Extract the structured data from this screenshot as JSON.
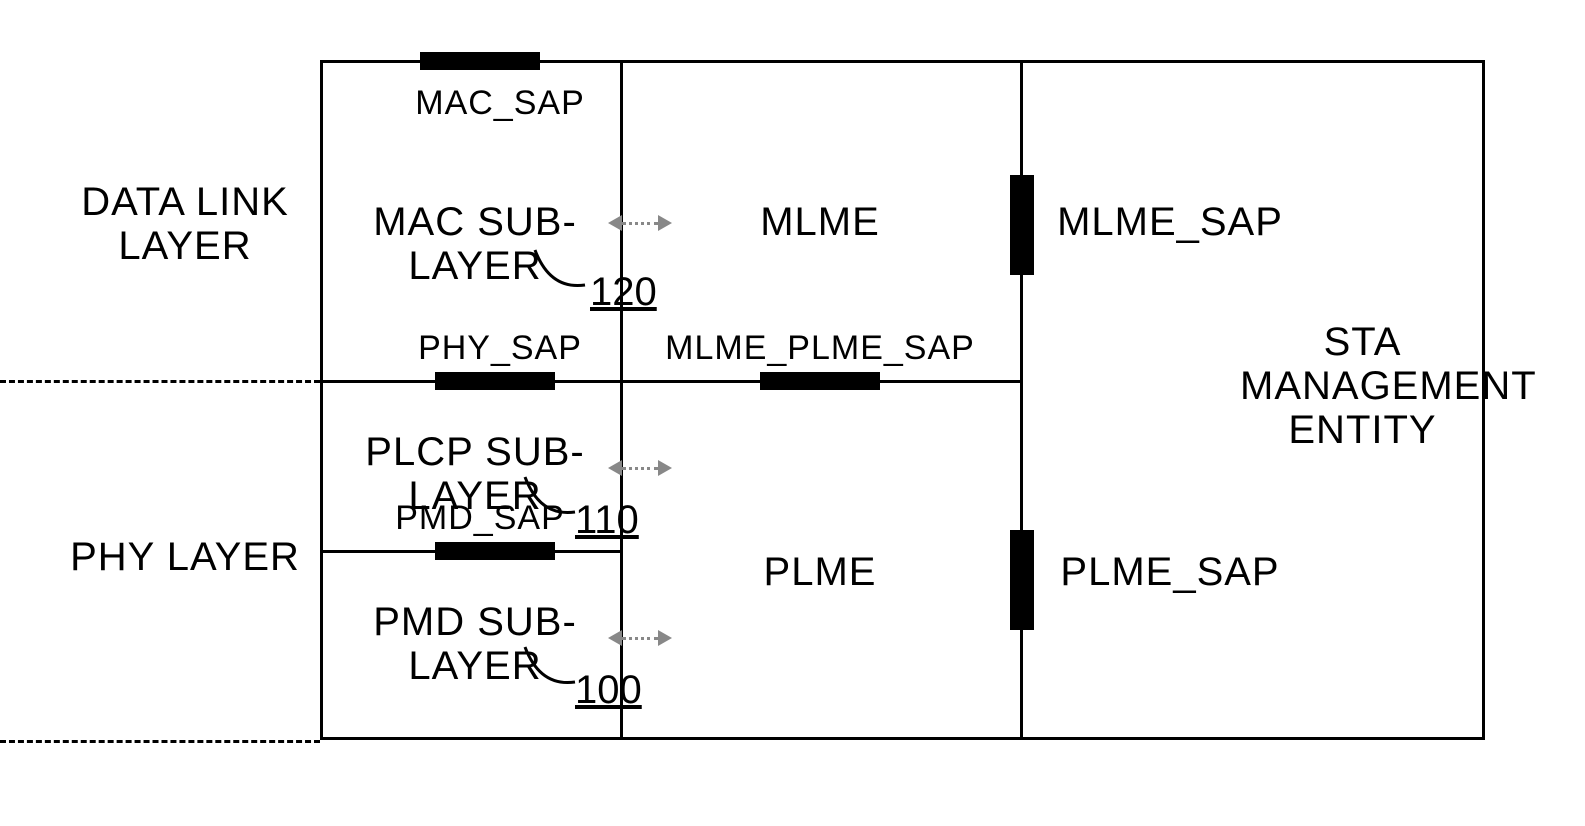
{
  "left": {
    "data_link": "DATA LINK\nLAYER",
    "phy": "PHY LAYER"
  },
  "top_sap": "MAC_SAP",
  "mac_sublayer": "MAC SUB-LAYER",
  "mlme": "MLME",
  "mlme_sap": "MLME_SAP",
  "phy_sap": "PHY_SAP",
  "mlme_plme_sap": "MLME_PLME_SAP",
  "plcp": "PLCP SUB-LAYER",
  "pmd_sap": "PMD_SAP",
  "pmd": "PMD SUB-LAYER",
  "plme": "PLME",
  "plme_sap": "PLME_SAP",
  "sta": "STA\nMANAGEMENT\nENTITY",
  "ref": {
    "mac": "120",
    "plcp": "110",
    "pmd": "100"
  }
}
